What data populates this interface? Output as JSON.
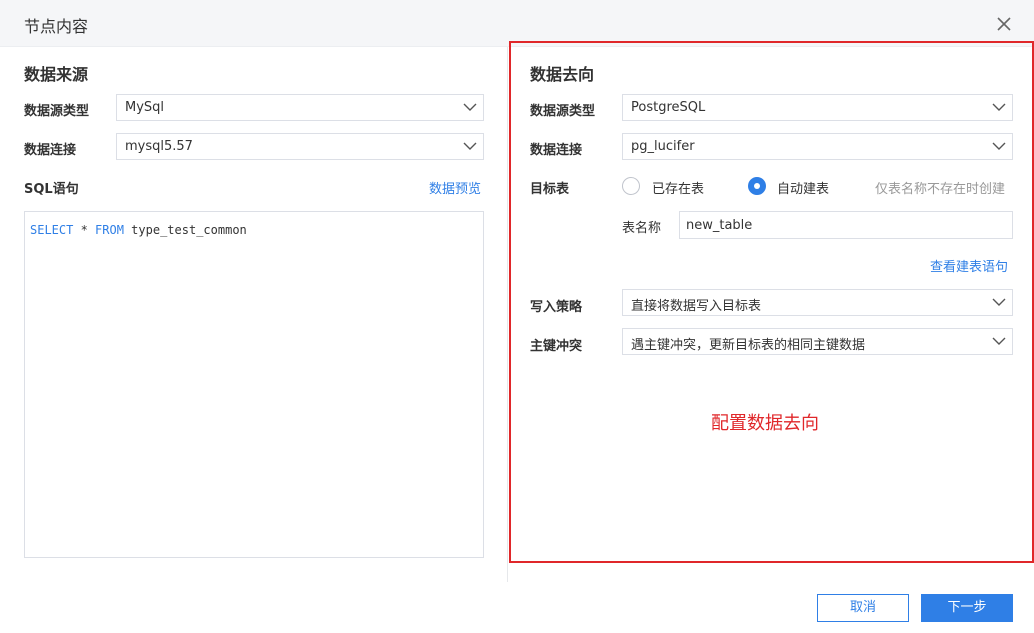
{
  "dialog": {
    "title": "节点内容",
    "close_icon": "close-icon"
  },
  "source": {
    "title": "数据来源",
    "type_label": "数据源类型",
    "type_value": "MySql",
    "conn_label": "数据连接",
    "conn_value": "mysql5.57",
    "sql_label": "SQL语句",
    "preview_link": "数据预览",
    "sql_tokens": {
      "select": "SELECT",
      "star": " * ",
      "from": "FROM",
      "table": " type_test_common"
    }
  },
  "target": {
    "title": "数据去向",
    "type_label": "数据源类型",
    "type_value": "PostgreSQL",
    "conn_label": "数据连接",
    "conn_value": "pg_lucifer",
    "table_label": "目标表",
    "option_existing": "已存在表",
    "option_auto": "自动建表",
    "selected_option": "自动建表",
    "auto_hint": "仅表名称不存在时创建",
    "table_name_label": "表名称",
    "table_name_value": "new_table",
    "view_ddl_link": "查看建表语句",
    "write_label": "写入策略",
    "write_value": "直接将数据写入目标表",
    "conflict_label": "主键冲突",
    "conflict_value": "遇主键冲突，更新目标表的相同主键数据"
  },
  "annotation": {
    "text": "配置数据去向",
    "color": "#e0272a"
  },
  "footer": {
    "cancel_label": "取消",
    "next_label": "下一步"
  },
  "colors": {
    "accent": "#2f7fe6",
    "highlight": "#e0272a"
  }
}
